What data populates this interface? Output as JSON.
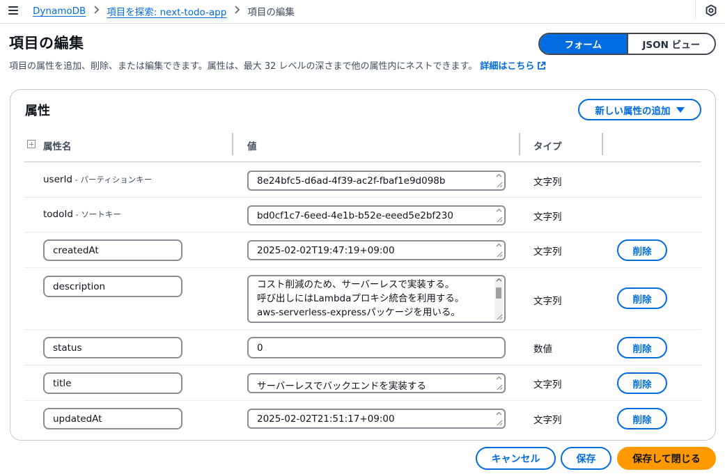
{
  "breadcrumb": {
    "items": [
      "DynamoDB",
      "項目を探索: next-todo-app"
    ],
    "current": "項目の編集"
  },
  "header": {
    "title": "項目の編集",
    "description": "項目の属性を追加、削除、または編集できます。属性は、最大 32 レベルの深さまで他の属性内にネストできます。",
    "learn_more": "詳細はこちら",
    "view_toggle": {
      "form": "フォーム",
      "json": "JSON ビュー",
      "selected": "フォーム"
    }
  },
  "attributes": {
    "title": "属性",
    "add_button": "新しい属性の追加",
    "columns": {
      "name": "属性名",
      "value": "値",
      "type": "タイプ"
    },
    "key_rows": [
      {
        "name": "userId",
        "role": " - パーティションキー",
        "value": "8e24bfc5-d6ad-4f39-ac2f-fbaf1e9d098b",
        "type": "文字列"
      },
      {
        "name": "todoId",
        "role": " - ソートキー",
        "value": "bd0cf1c7-6eed-4e1b-b52e-eeed5e2bf230",
        "type": "文字列"
      }
    ],
    "rows": [
      {
        "name": "createdAt",
        "value": "2025-02-02T19:47:19+09:00",
        "type": "文字列",
        "delete": "削除"
      },
      {
        "name": "description",
        "value_lines": [
          "コスト削減のため、サーバーレスで実装する。",
          "呼び出しにはLambdaプロキシ統合を利用する。",
          "aws-serverless-expressパッケージを用いる。"
        ],
        "type": "文字列",
        "delete": "削除"
      },
      {
        "name": "status",
        "value": "0",
        "type": "数値",
        "delete": "削除"
      },
      {
        "name": "title",
        "value": "サーバーレスでバックエンドを実装する",
        "type": "文字列",
        "delete": "削除"
      },
      {
        "name": "updatedAt",
        "value": "2025-02-02T21:51:17+09:00",
        "type": "文字列",
        "delete": "削除"
      }
    ]
  },
  "footer": {
    "cancel": "キャンセル",
    "save": "保存",
    "save_close": "保存して閉じる"
  },
  "colors": {
    "link": "#006ce0",
    "primary_button": "#ff9900",
    "border": "#8c8c94"
  }
}
